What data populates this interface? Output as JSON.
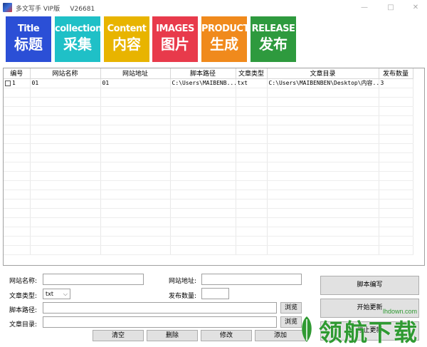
{
  "window": {
    "title": "多文写手 VIP版     V26681",
    "controls": {
      "minimize": "—",
      "maximize": "□",
      "close": "✕"
    }
  },
  "toolbar": [
    {
      "en": "Title",
      "zh": "标题",
      "color": "#2b4fd6"
    },
    {
      "en": "collection",
      "zh": "采集",
      "color": "#1fc0c7"
    },
    {
      "en": "Content",
      "zh": "内容",
      "color": "#e8b400"
    },
    {
      "en": "IMAGES",
      "zh": "图片",
      "color": "#e83a4b"
    },
    {
      "en": "PRODUCTs",
      "zh": "生成",
      "color": "#f08a1c"
    },
    {
      "en": "RELEASE",
      "zh": "发布",
      "color": "#2e9a3e"
    }
  ],
  "table": {
    "columns": [
      "编号",
      "网站名称",
      "网站地址",
      "脚本路径",
      "文章类型",
      "文章目录",
      "发布数量"
    ],
    "rows": [
      [
        "1",
        "01",
        "01",
        "C:\\Users\\MAIBENB...",
        "txt",
        "C:\\Users\\MAIBENBEN\\Desktop\\内容...",
        "3"
      ]
    ]
  },
  "form": {
    "site_name_label": "网站名称:",
    "site_name_value": "",
    "site_url_label": "网站地址:",
    "site_url_value": "",
    "article_type_label": "文章类型:",
    "article_type_value": "txt",
    "publish_count_label": "发布数量:",
    "publish_count_value": "",
    "script_path_label": "脚本路径:",
    "script_path_value": "",
    "article_dir_label": "文章目录:",
    "article_dir_value": "",
    "browse_label": "浏览",
    "browse2_label": "浏览",
    "clear_label": "清空",
    "delete_label": "删除",
    "modify_label": "修改",
    "add_label": "添加",
    "script_write_label": "脚本编写",
    "start_update_label": "开始更新",
    "stop_update_label": "停止更新"
  },
  "watermark": {
    "text": "领航下载",
    "url": "lhdown.com",
    "color": "#2f9a32"
  }
}
